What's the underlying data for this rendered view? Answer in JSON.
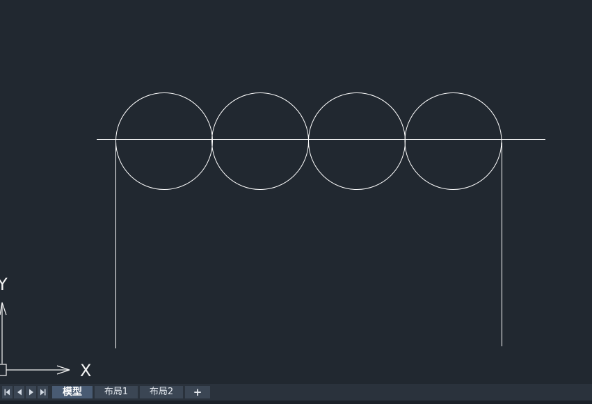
{
  "app": {
    "background_color": "#212830",
    "drawing_color": "#ffffff"
  },
  "ucs": {
    "x_label": "X",
    "y_label": "Y"
  },
  "tabbar": {
    "nav_buttons": [
      {
        "name": "first-layout-button",
        "icon": "skip-first-icon"
      },
      {
        "name": "previous-layout-button",
        "icon": "triangle-left-icon"
      },
      {
        "name": "next-layout-button",
        "icon": "triangle-right-icon"
      },
      {
        "name": "last-layout-button",
        "icon": "skip-last-icon"
      }
    ],
    "tabs": [
      {
        "label": "模型",
        "active": true
      },
      {
        "label": "布局1",
        "active": false
      },
      {
        "label": "布局2",
        "active": false
      }
    ],
    "add_label": "+"
  }
}
